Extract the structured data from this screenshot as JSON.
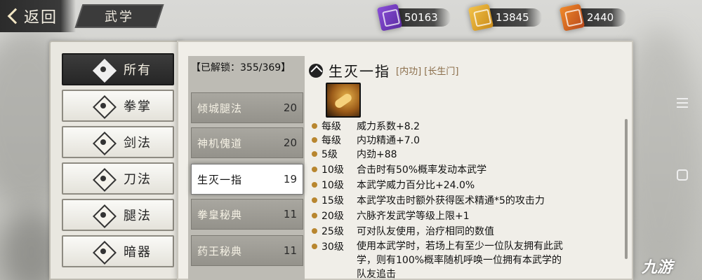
{
  "topbar": {
    "back_label": "返回",
    "title": "武学",
    "currencies": [
      {
        "icon": "purple-token-icon",
        "value": "50163"
      },
      {
        "icon": "gold-token-icon",
        "value": "13845"
      },
      {
        "icon": "orange-token-icon",
        "value": "2440"
      }
    ]
  },
  "categories": [
    {
      "label": "所有",
      "icon": "all-icon",
      "active": true
    },
    {
      "label": "拳掌",
      "icon": "fist-icon",
      "active": false
    },
    {
      "label": "剑法",
      "icon": "sword-icon",
      "active": false
    },
    {
      "label": "刀法",
      "icon": "blade-icon",
      "active": false
    },
    {
      "label": "腿法",
      "icon": "kick-icon",
      "active": false
    },
    {
      "label": "暗器",
      "icon": "dart-icon",
      "active": false
    }
  ],
  "list": {
    "unlocked_label": "【已解锁：355/369】",
    "skills": [
      {
        "name": "倾城腿法",
        "level": "20",
        "active": false
      },
      {
        "name": "神机傀道",
        "level": "20",
        "active": false
      },
      {
        "name": "生灭一指",
        "level": "19",
        "active": true
      },
      {
        "name": "拳皇秘典",
        "level": "11",
        "active": false
      },
      {
        "name": "药王秘典",
        "level": "11",
        "active": false
      }
    ]
  },
  "detail": {
    "title": "生灭一指",
    "tags": "[内功] [长生门]",
    "effects": [
      {
        "level": "每级",
        "text": "威力系数+8.2"
      },
      {
        "level": "每级",
        "text": "内功精通+7.0"
      },
      {
        "level": "5级",
        "text": "内劲+88"
      },
      {
        "level": "10级",
        "text": "合击时有50%概率发动本武学"
      },
      {
        "level": "10级",
        "text": "本武学威力百分比+24.0%"
      },
      {
        "level": "15级",
        "text": "本武学攻击时额外获得医术精通*5的攻击力"
      },
      {
        "level": "20级",
        "text": "六脉齐发武学等级上限+1"
      },
      {
        "level": "25级",
        "text": "可对队友使用，治疗相同的数值"
      },
      {
        "level": "30级",
        "text": "使用本武学时，若场上有至少一位队友拥有此武学，则有100%概率随机呼唤一位拥有本武学的队友追击"
      }
    ]
  },
  "watermark": "九游"
}
